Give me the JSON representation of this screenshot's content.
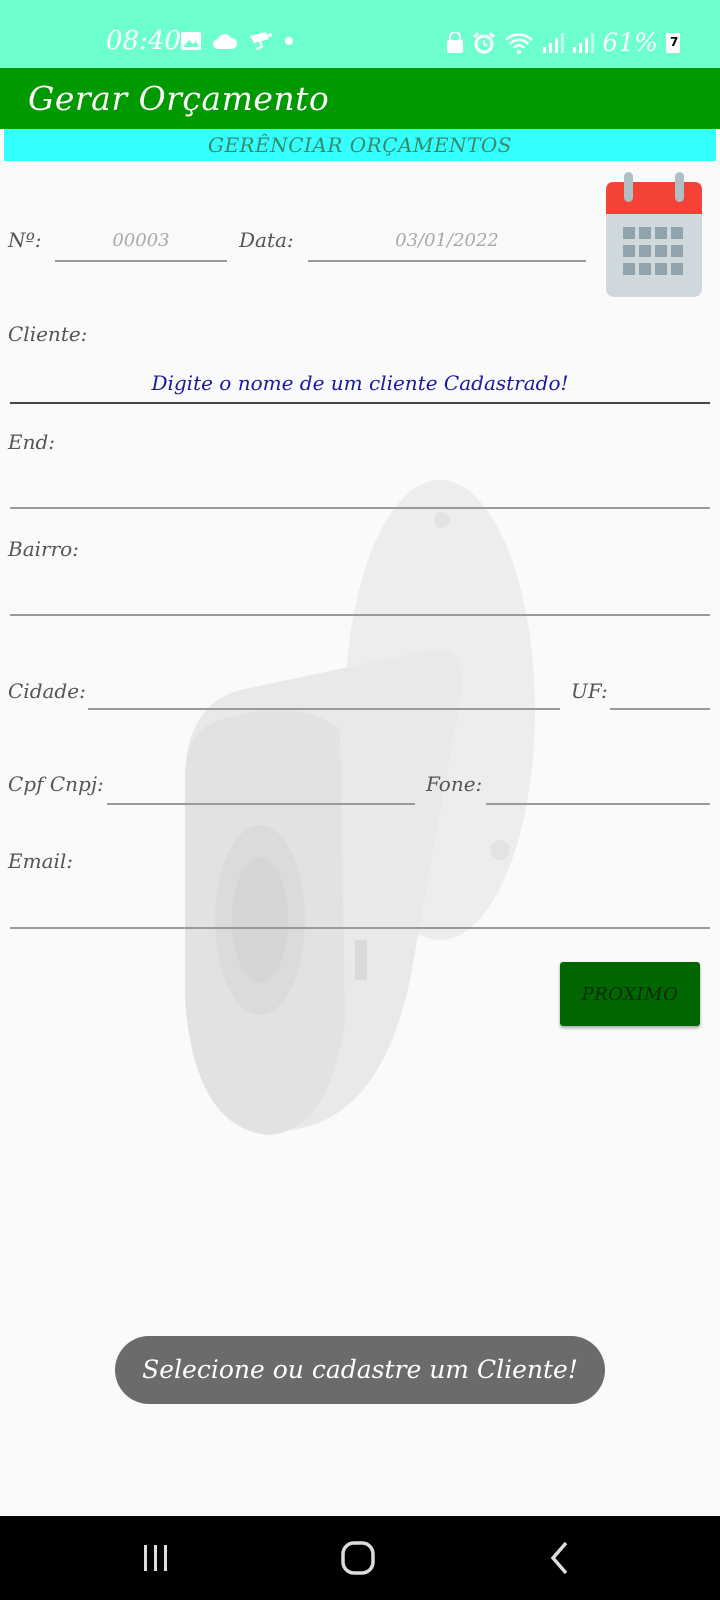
{
  "status_bar": {
    "time": "08:40",
    "battery_percent": "61%",
    "battery_badge": "7",
    "icons_left": [
      "image-icon",
      "cloud-icon",
      "cctv-icon",
      "dot-icon"
    ],
    "icons_right": [
      "lock-icon",
      "alarm-icon",
      "wifi-icon",
      "signal-icon",
      "signal-icon",
      "battery-icon"
    ]
  },
  "app_bar": {
    "title": "Gerar Orçamento"
  },
  "banner": {
    "label": "GERÊNCIAR ORÇAMENTOS"
  },
  "form": {
    "number_label": "Nº:",
    "number_value": "00003",
    "date_label": "Data:",
    "date_value": "03/01/2022",
    "client_label": "Cliente:",
    "client_placeholder": "Digite o nome de um cliente Cadastrado!",
    "address_label": "End:",
    "neighborhood_label": "Bairro:",
    "city_label": "Cidade:",
    "state_label": "UF:",
    "cpf_label": "Cpf Cnpj:",
    "phone_label": "Fone:",
    "email_label": "Email:"
  },
  "actions": {
    "next_label": "PROXIMO"
  },
  "toast": {
    "message": "Selecione ou cadastre um Cliente!"
  },
  "colors": {
    "status_bar": "#6dffd0",
    "app_bar": "#009900",
    "banner": "#33ffff",
    "next_button": "#006600",
    "toast": "#6b6b6b",
    "client_hint": "#1a1a9a"
  }
}
